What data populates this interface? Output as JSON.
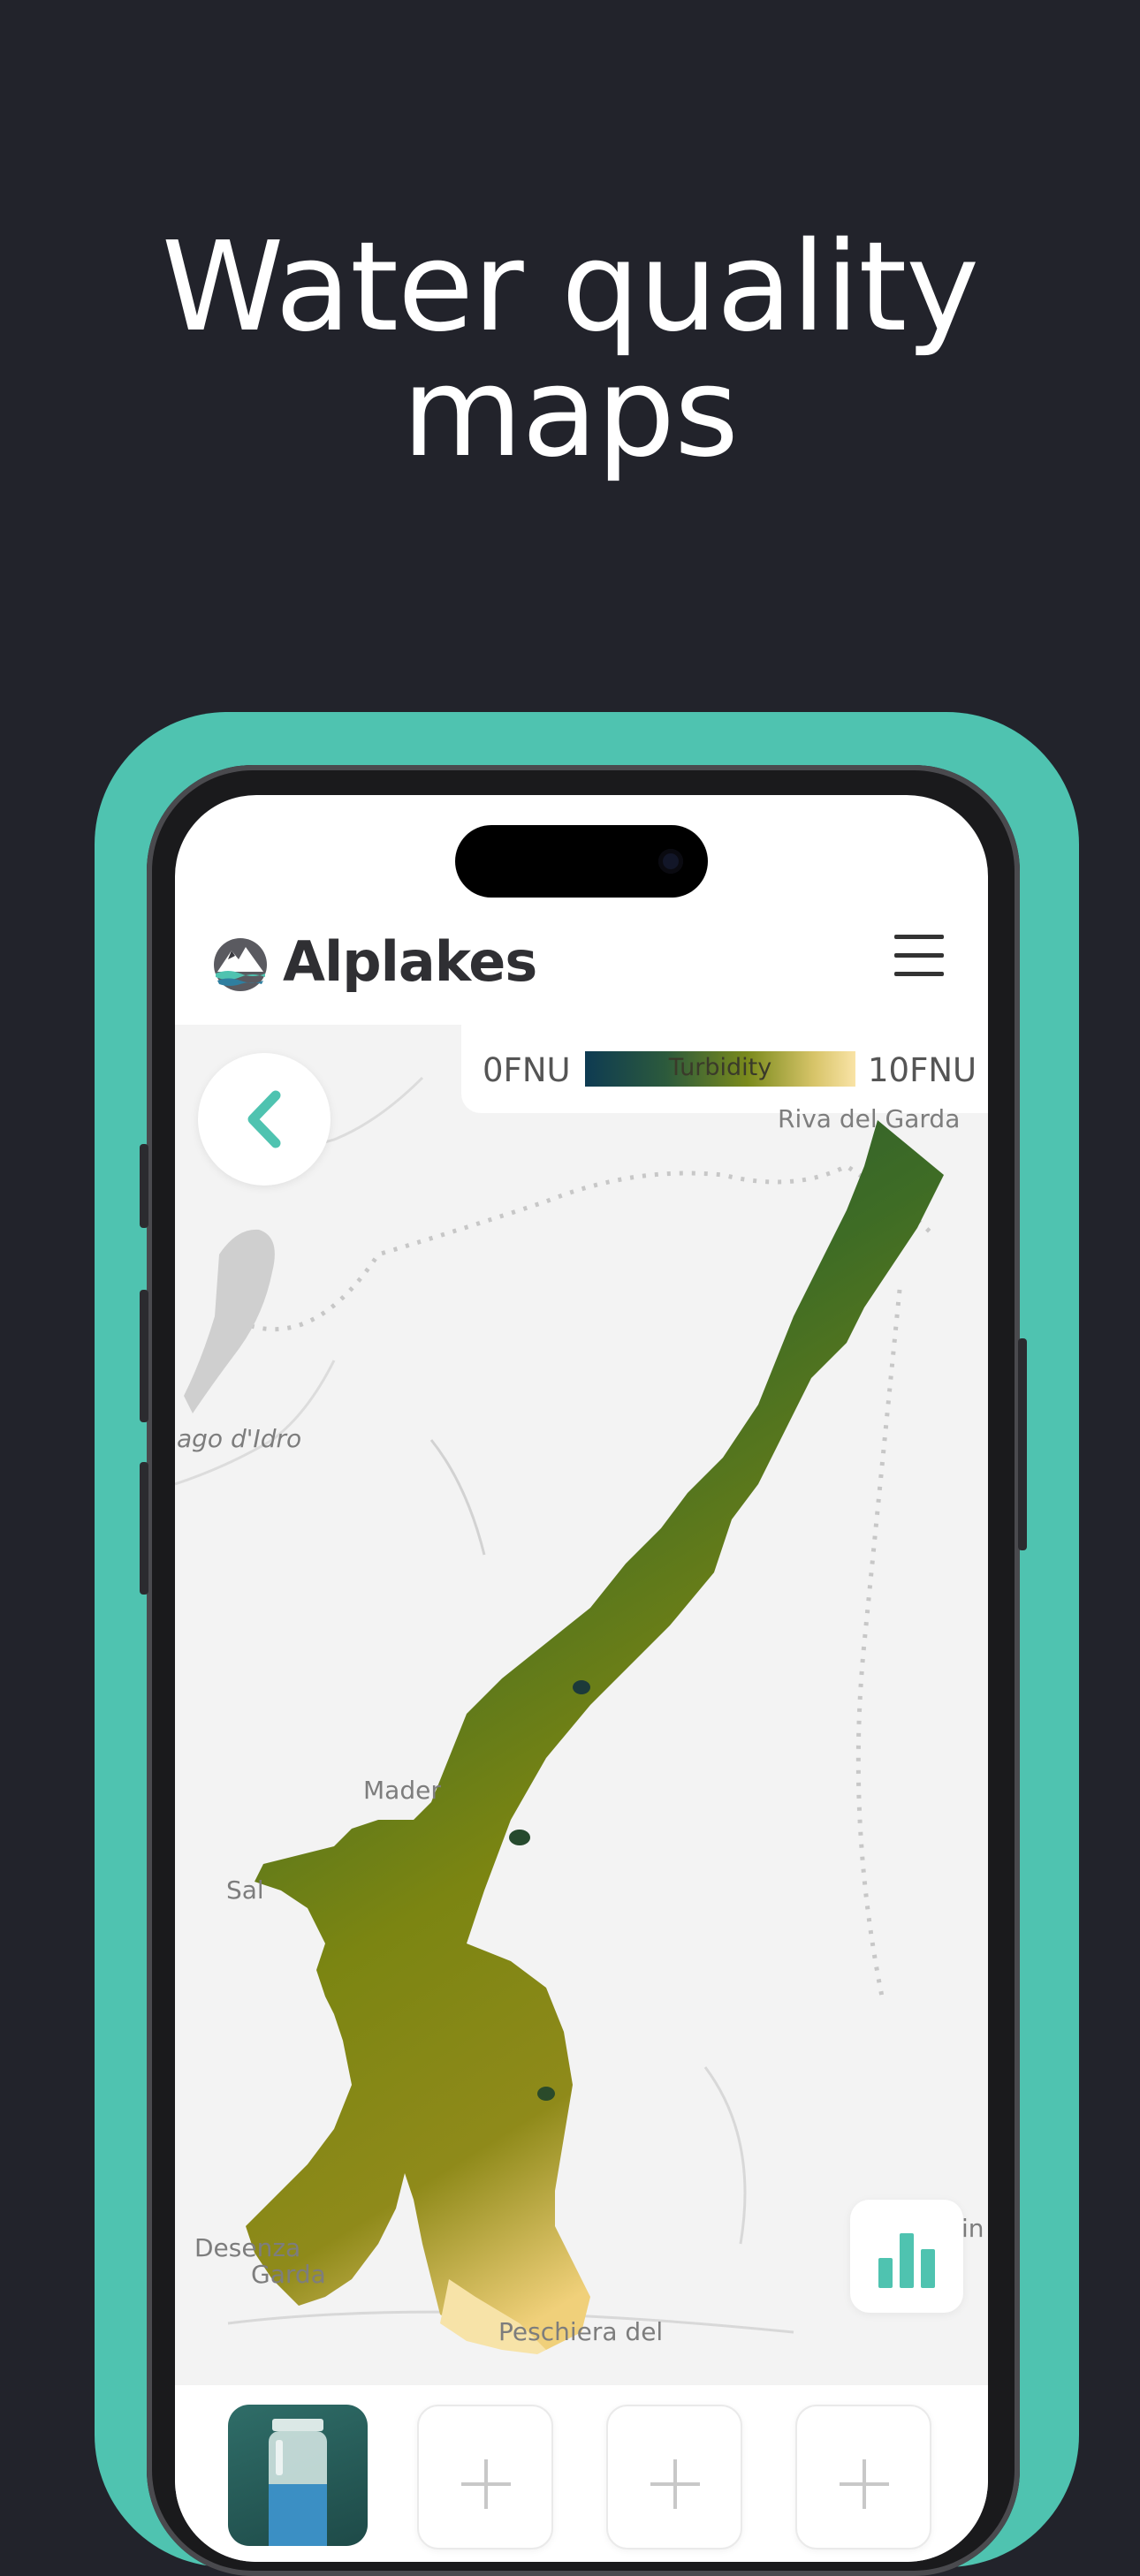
{
  "headline": {
    "line1": "Water quality",
    "line2": "maps"
  },
  "app": {
    "brand": "Alplakes",
    "icons": {
      "logo": "mountain-lake-logo",
      "menu": "hamburger-menu-icon",
      "back": "chevron-left-icon",
      "chart": "bar-chart-icon",
      "add": "plus-icon",
      "layer": "water-bottle-icon"
    }
  },
  "legend": {
    "min": "0FNU",
    "max": "10FNU",
    "label": "Turbidity"
  },
  "map_labels": {
    "riva": "Riva del Garda",
    "idro": "ago d'Idro",
    "maderno": "Mader",
    "salo": "Sal",
    "desenzano1": "Desenza",
    "desenzano2": "Garda",
    "peschiera": "Peschiera del",
    "right_edge": "in"
  },
  "colors": {
    "background": "#22232b",
    "accent": "#4fc3b0",
    "text_light": "#ffffff"
  }
}
